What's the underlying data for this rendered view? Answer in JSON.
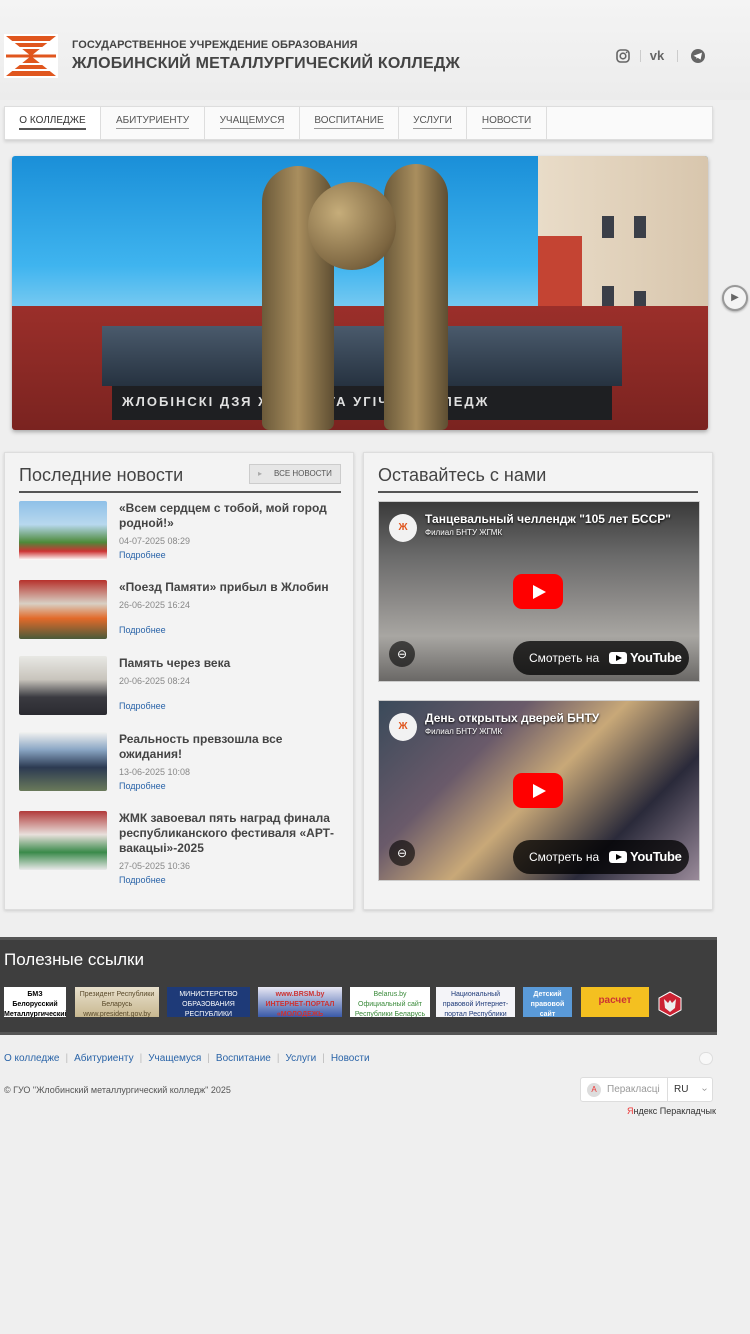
{
  "header": {
    "subtitle": "ГОСУДАРСТВЕННОЕ УЧРЕЖДЕНИЕ ОБРАЗОВАНИЯ",
    "title": "ЖЛОБИНСКИЙ МЕТАЛЛУРГИЧЕСКИЙ КОЛЛЕДЖ",
    "logo_color": "#e0561e",
    "social": [
      "instagram-icon",
      "vk-icon",
      "telegram-icon"
    ]
  },
  "nav": {
    "items": [
      "О КОЛЛЕДЖЕ",
      "АБИТУРИЕНТУ",
      "УЧАЩЕМУСЯ",
      "ВОСПИТАНИЕ",
      "УСЛУГИ",
      "НОВОСТИ"
    ],
    "active_index": 0
  },
  "hero": {
    "banner_text": "ЖЛОБІНСКІ ДЗЯ      ЖНЫ МЕТА   УГІЧНЫ КАЛЕДЖ"
  },
  "news": {
    "title": "Последние новости",
    "all_label": "ВСЕ НОВОСТИ",
    "items": [
      {
        "title": "«Всем сердцем с тобой, мой город родной!»",
        "date": "04-07-2025 08:29",
        "more": "Подробнее"
      },
      {
        "title": "«Поезд Памяти» прибыл в Жлобин",
        "date": "26-06-2025 16:24",
        "more": "Подробнее"
      },
      {
        "title": "Память через века",
        "date": "20-06-2025 08:24",
        "more": "Подробнее"
      },
      {
        "title": "Реальность превзошла все ожидания!",
        "date": "13-06-2025 10:08",
        "more": "Подробнее"
      },
      {
        "title": "ЖМК завоевал пять наград финала республиканского фестиваля «АРТ-вакацыі»-2025",
        "date": "27-05-2025 10:36",
        "more": "Подробнее"
      }
    ]
  },
  "stay": {
    "title": "Оставайтесь с нами",
    "videos": [
      {
        "title": "Танцевальный челлендж \"105 лет БССР\"",
        "channel": "Филиал БНТУ ЖГМК",
        "watch_label": "Смотреть на",
        "yt": "YouTube"
      },
      {
        "title": "День открытых дверей БНТУ",
        "channel": "Филиал БНТУ ЖГМК",
        "watch_label": "Смотреть на",
        "yt": "YouTube"
      }
    ]
  },
  "links": {
    "title": "Полезные ссылки",
    "banners": [
      {
        "text": "БМЗ Белорусский Металлургический Завод"
      },
      {
        "text": "Президент Республики Беларусь www.president.gov.by"
      },
      {
        "text": "МИНИСТЕРСТВО ОБРАЗОВАНИЯ РЕСПУБЛИКИ БЕЛАРУСЬ www.minedu.unibel.by"
      },
      {
        "text": "www.BRSM.by ИНТЕРНЕТ-ПОРТАЛ «МОЛОДЕЖЬ БЕЛАРУСИ»"
      },
      {
        "text": "Belarus.by Официальный сайт Республики Беларусь"
      },
      {
        "text": "Национальный правовой Интернет-портал Республики Беларусь www.pravo.by"
      },
      {
        "text": "Детский правовой сайт"
      },
      {
        "text": "расчет"
      },
      {
        "text": ""
      }
    ]
  },
  "footer": {
    "links": [
      "О колледже",
      "Абитуриенту",
      "Учащемуся",
      "Воспитание",
      "Услуги",
      "Новости"
    ],
    "copyright": "© ГУО \"Жлобинский металлургический колледж\" 2025",
    "translate_label": "Перакласці",
    "lang": "RU",
    "yandex_first": "Я",
    "yandex_rest": "ндекс Перакладчык"
  }
}
